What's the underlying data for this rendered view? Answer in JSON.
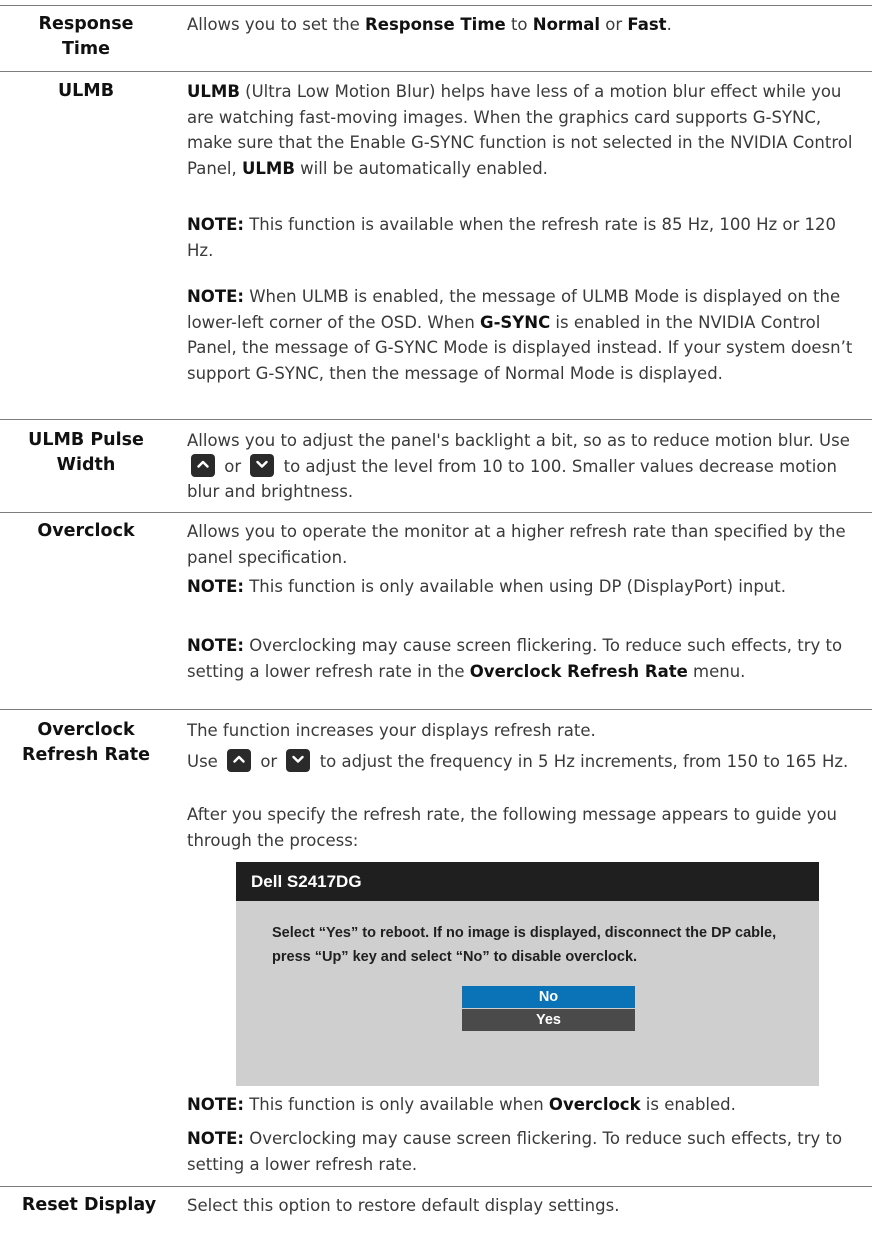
{
  "rows": {
    "response_time": {
      "term": [
        "Response",
        "Time"
      ],
      "desc": [
        "Allows you to set the ",
        "Response Time",
        " to ",
        "Normal",
        " or ",
        "Fast",
        "."
      ]
    },
    "ulmb": {
      "term": "ULMB",
      "p1": [
        "ULMB",
        " (Ultra Low Motion Blur) helps have less of a motion blur effect while you are watching fast-moving images. When the graphics card supports G-SYNC, make sure that the Enable G-SYNC function is not selected in the NVIDIA Control Panel, ",
        "ULMB",
        " will be automatically enabled."
      ],
      "note1": [
        "NOTE:",
        " This function is available when the refresh rate is 85 Hz, 100 Hz or 120 Hz."
      ],
      "note2": [
        "NOTE:",
        " When ULMB is enabled, the message of ULMB Mode is displayed on the lower-left corner of the OSD. When ",
        "G-SYNC",
        " is enabled in the NVIDIA Control Panel, the message of G-SYNC Mode is displayed instead. If your system doesn’t support G-SYNC, then the message of Normal Mode is displayed."
      ]
    },
    "ulmb_pulse": {
      "term": [
        "ULMB Pulse",
        "Width"
      ],
      "desc": [
        "Allows you to adjust the panel's backlight a bit, so as to reduce motion blur. Use ",
        " or ",
        " to adjust the level from 10 to 100. Smaller values decrease motion blur and brightness."
      ]
    },
    "overclock": {
      "term": "Overclock",
      "desc": "Allows you to operate the monitor at a higher refresh rate than specified by the panel specification.",
      "note1": [
        "NOTE:",
        " This function is only available when using DP (DisplayPort) input."
      ],
      "note2": [
        "NOTE:",
        " Overclocking may cause screen flickering. To reduce such effects, try to setting a lower refresh rate in the ",
        "Overclock Refresh Rate",
        " menu."
      ]
    },
    "overclock_rate": {
      "term": [
        "Overclock",
        "Refresh Rate"
      ],
      "p1": "The function increases your displays refresh rate.",
      "p2": [
        "Use ",
        " or ",
        " to adjust the frequency in 5 Hz increments, from 150 to 165 Hz."
      ],
      "p3": "After you specify the refresh rate, the following message appears to guide you through the process:",
      "note1": [
        "NOTE:",
        " This function is only available when ",
        "Overclock",
        " is enabled."
      ],
      "note2": [
        "NOTE:",
        " Overclocking may cause screen flickering. To reduce such effects, try to setting a lower refresh rate."
      ]
    },
    "reset_display": {
      "term": "Reset Display",
      "desc": "Select this option to restore default display settings."
    }
  },
  "osd": {
    "title": "Dell S2417DG",
    "message_line1": "Select “Yes” to reboot. If no image is displayed, disconnect the DP cable,",
    "message_line2": "press “Up” key and select “No” to disable overclock.",
    "option_no": "No",
    "option_yes": "Yes",
    "colors": {
      "header": "#1f1f1f",
      "body": "#cfcfcf",
      "selected": "#0a73b8",
      "unselected": "#4a4a4a"
    }
  },
  "icons": {
    "up": "chevron-up-icon",
    "down": "chevron-down-icon"
  }
}
